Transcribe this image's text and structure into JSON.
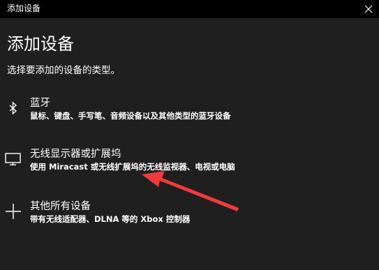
{
  "window": {
    "title": "添加设备",
    "close_icon": "close-icon"
  },
  "main": {
    "heading": "添加设备",
    "subtitle": "选择要添加的设备的类型。"
  },
  "options": [
    {
      "icon": "bluetooth-icon",
      "title": "蓝牙",
      "description": "鼠标、键盘、手写笔、音频设备以及其他类型的蓝牙设备"
    },
    {
      "icon": "monitor-icon",
      "title": "无线显示器或扩展坞",
      "description": "使用 Miracast 或无线扩展坞的无线监视器、电视或电脑"
    },
    {
      "icon": "plus-icon",
      "title": "其他所有设备",
      "description": "带有无线适配器、DLNA 等的 Xbox 控制器"
    }
  ],
  "annotation": {
    "arrow_color": "#f03a3a"
  }
}
